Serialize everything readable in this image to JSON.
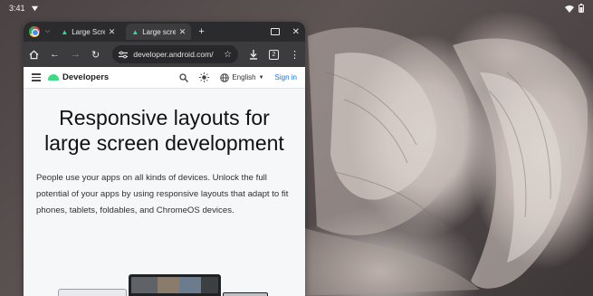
{
  "status_bar": {
    "time": "3:41"
  },
  "browser": {
    "tabs": [
      {
        "title": "Large Screen",
        "active": false
      },
      {
        "title": "Large screen",
        "active": true
      }
    ],
    "url": "developer.android.com/",
    "tab_count": "2"
  },
  "site": {
    "brand": "Developers",
    "language": "English",
    "signin": "Sign in"
  },
  "hero": {
    "title": "Responsive layouts for large screen development",
    "description": "People use your apps on all kinds of devices. Unlock the full potential of your apps by using responsive layouts that adapt to fit phones, tablets, foldables, and ChromeOS devices."
  },
  "colors": {
    "accent": "#1a73e8",
    "android_green": "#3ddc84",
    "chrome_dark": "#2b2b2d"
  }
}
